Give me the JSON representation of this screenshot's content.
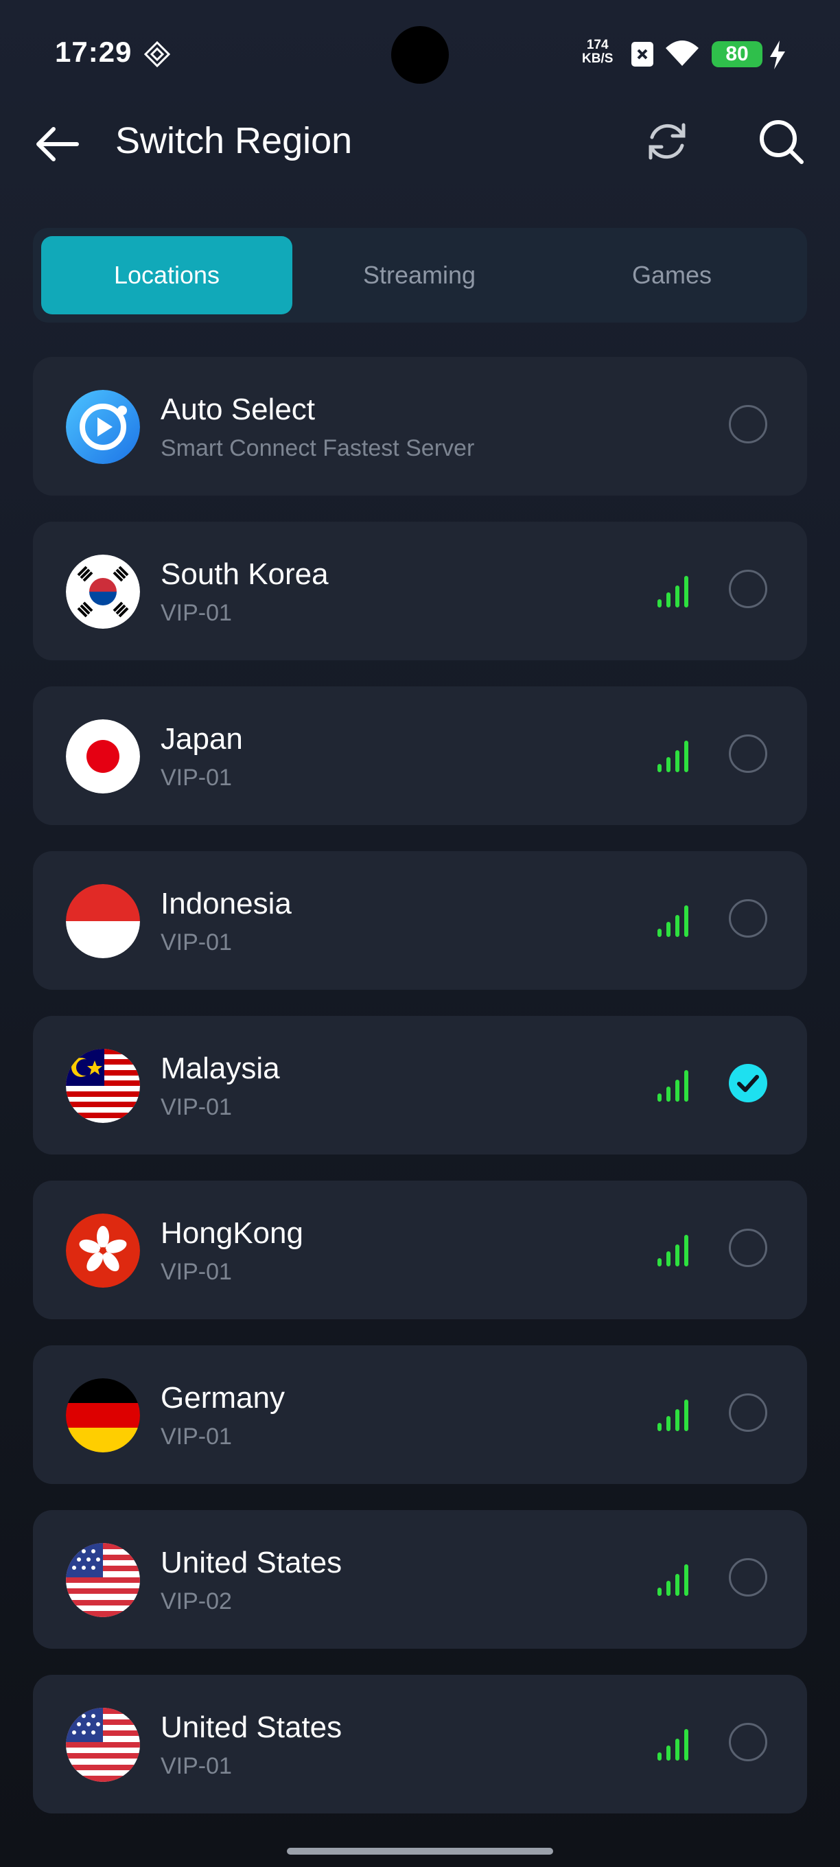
{
  "status_bar": {
    "time": "17:29",
    "net_speed_value": "174",
    "net_speed_unit": "KB/S",
    "battery": "80"
  },
  "header": {
    "title": "Switch Region",
    "back_icon": "arrow-left-icon",
    "refresh_icon": "refresh-icon",
    "search_icon": "search-icon"
  },
  "tabs": [
    {
      "label": "Locations",
      "active": true
    },
    {
      "label": "Streaming",
      "active": false
    },
    {
      "label": "Games",
      "active": false
    }
  ],
  "colors": {
    "accent": "#11a9b9",
    "signal": "#2ee03f",
    "selected": "#1ee0f0"
  },
  "regions": [
    {
      "name": "Auto Select",
      "subtitle": "Smart Connect Fastest Server",
      "flag": "auto-select-icon",
      "signal": "",
      "selected": false
    },
    {
      "name": "South Korea",
      "subtitle": "VIP-01",
      "flag": "south-korea-flag-icon",
      "signal": "signal-icon",
      "selected": false
    },
    {
      "name": "Japan",
      "subtitle": "VIP-01",
      "flag": "japan-flag-icon",
      "signal": "signal-icon",
      "selected": false
    },
    {
      "name": "Indonesia",
      "subtitle": "VIP-01",
      "flag": "indonesia-flag-icon",
      "signal": "signal-icon",
      "selected": false
    },
    {
      "name": "Malaysia",
      "subtitle": "VIP-01",
      "flag": "malaysia-flag-icon",
      "signal": "signal-icon",
      "selected": true
    },
    {
      "name": "HongKong",
      "subtitle": "VIP-01",
      "flag": "hongkong-flag-icon",
      "signal": "signal-icon",
      "selected": false
    },
    {
      "name": "Germany",
      "subtitle": "VIP-01",
      "flag": "germany-flag-icon",
      "signal": "signal-icon",
      "selected": false
    },
    {
      "name": "United States",
      "subtitle": "VIP-02",
      "flag": "usa-flag-icon",
      "signal": "signal-icon",
      "selected": false
    },
    {
      "name": "United States",
      "subtitle": "VIP-01",
      "flag": "usa-flag-icon",
      "signal": "signal-icon",
      "selected": false
    }
  ]
}
